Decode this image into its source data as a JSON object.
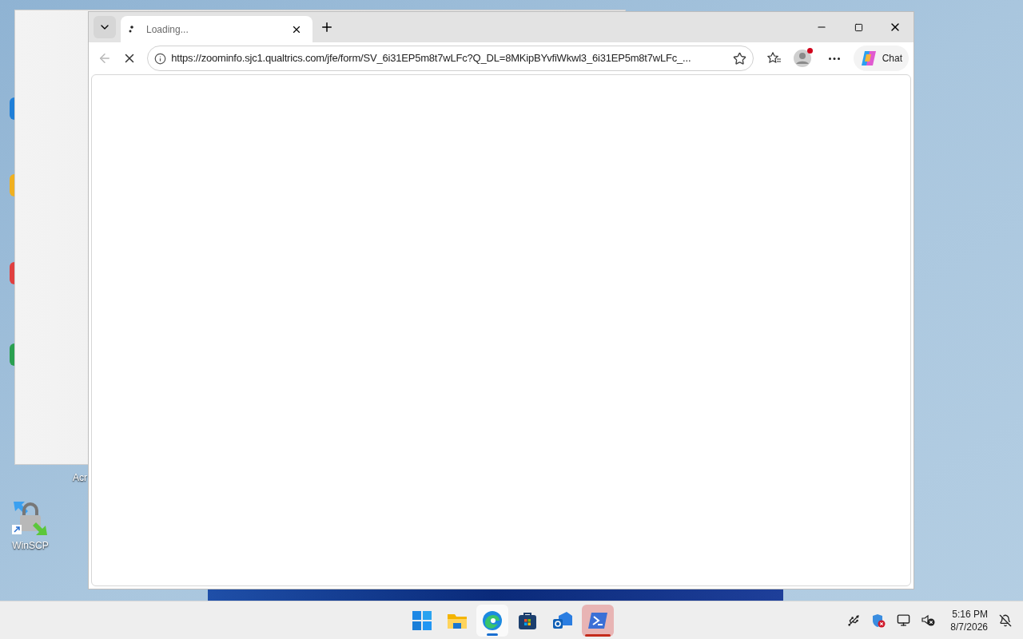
{
  "desktop": {
    "icon_fragments": [
      {
        "label": "Acr"
      }
    ],
    "icons": [
      {
        "label": "WinSCP"
      }
    ]
  },
  "browser": {
    "tabs": [
      {
        "title": "Loading...",
        "selected": true,
        "loading": true
      }
    ],
    "address_bar": {
      "url": "https://zoominfo.sjc1.qualtrics.com/jfe/form/SV_6i31EP5m8t7wLFc?Q_DL=8MKipBYvfiWkwl3_6i31EP5m8t7wLFc_..."
    },
    "back_disabled": true,
    "profile_notification": true,
    "chat_button": "Chat"
  },
  "taskbar": {
    "apps": [
      {
        "kind": "start",
        "selected": false,
        "attention": false
      },
      {
        "kind": "explorer",
        "selected": false,
        "attention": false
      },
      {
        "kind": "edge",
        "selected": true,
        "attention": false
      },
      {
        "kind": "store",
        "selected": false,
        "attention": false
      },
      {
        "kind": "outlook",
        "selected": false,
        "attention": false
      },
      {
        "kind": "powershell",
        "selected": false,
        "attention": true
      }
    ],
    "clock": {
      "time": "5:16 PM",
      "date": "8/7/2026"
    }
  }
}
